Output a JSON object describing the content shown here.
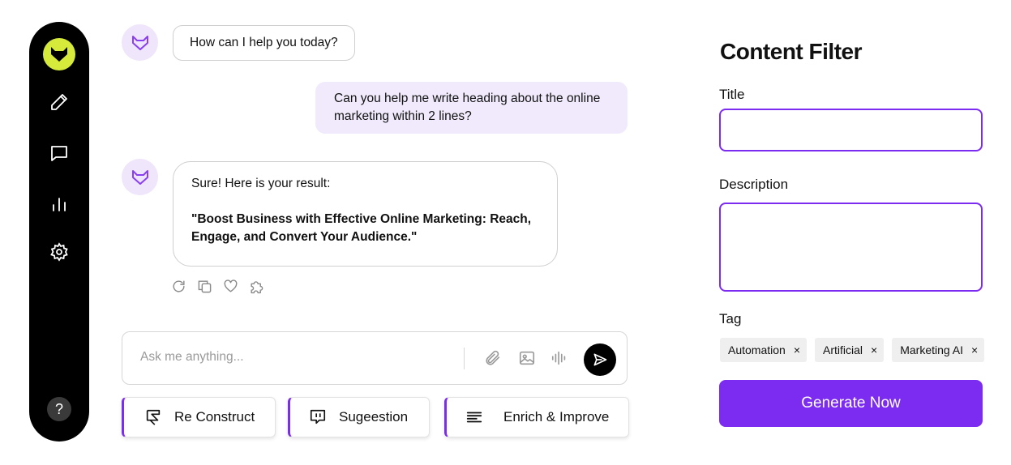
{
  "sidebar": {
    "logo_icon": "fox-logo-icon",
    "items": [
      {
        "icon": "pencil-icon"
      },
      {
        "icon": "chat-icon"
      },
      {
        "icon": "bar-chart-icon"
      },
      {
        "icon": "gear-icon"
      }
    ],
    "help_label": "?"
  },
  "chat": {
    "messages": [
      {
        "role": "bot",
        "text": "How can I help you today?"
      },
      {
        "role": "user",
        "text": "Can you help me write heading about the online marketing within 2 lines?"
      },
      {
        "role": "bot",
        "text": "Sure! Here is your result:",
        "result": "\"Boost Business with Effective Online Marketing: Reach, Engage, and Convert Your Audience.\""
      }
    ],
    "message_actions": [
      "refresh-icon",
      "copy-icon",
      "heart-icon",
      "puzzle-icon"
    ],
    "input": {
      "placeholder": "Ask me anything...",
      "value": ""
    },
    "input_icons": [
      "paperclip-icon",
      "image-icon",
      "voice-icon",
      "send-icon"
    ]
  },
  "suggestions": [
    {
      "label": "Re Construct",
      "icon": "reconstruct-icon"
    },
    {
      "label": "Sugeestion",
      "icon": "suggestion-icon"
    },
    {
      "label": "Enrich & Improve",
      "icon": "text-lines-icon"
    }
  ],
  "panel": {
    "title": "Content Filter",
    "title_label": "Title",
    "title_value": "",
    "description_label": "Description",
    "description_value": "",
    "tag_label": "Tag",
    "tags": [
      "Automation",
      "Artificial",
      "Marketing AI"
    ],
    "tag_remove": "×",
    "generate_label": "Generate Now"
  },
  "colors": {
    "accent": "#7c2bf0",
    "logo_bg": "#d6ea3b",
    "sidebar_bg": "#000000",
    "user_bubble": "#f1eafc",
    "avatar_bg": "#efe6fb"
  }
}
